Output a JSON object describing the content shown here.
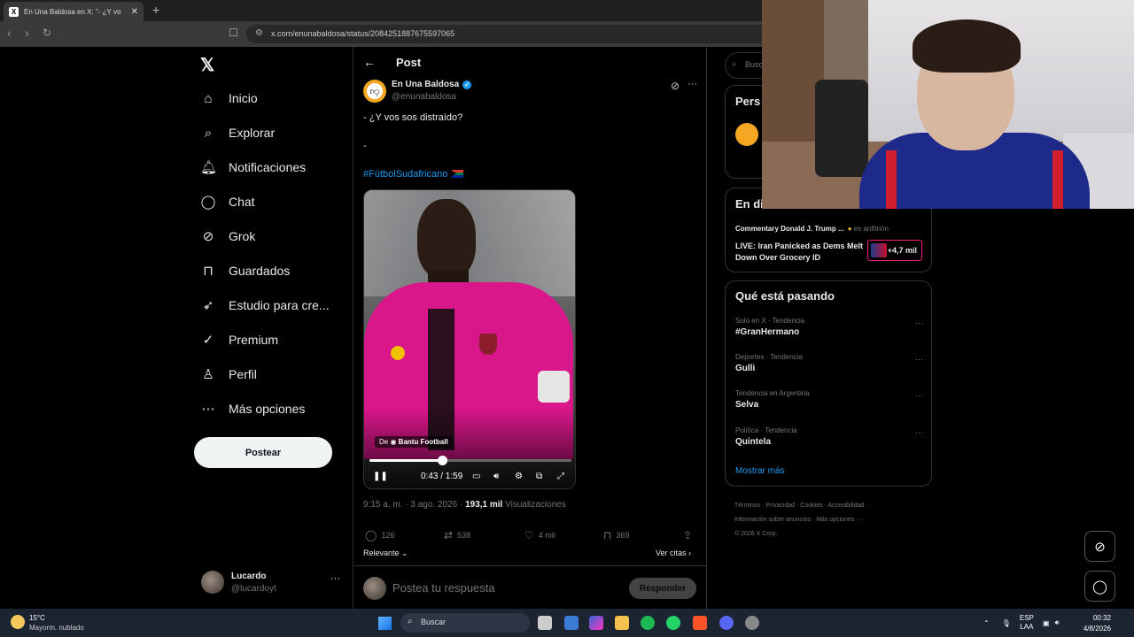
{
  "browser": {
    "tab_title": "En Una Baldosa en X: \"- ¿Y vo",
    "url": "x.com/enunabaldosa/status/2084251887675597065"
  },
  "nav": {
    "items": [
      {
        "label": "Inicio",
        "icon": "home-icon"
      },
      {
        "label": "Explorar",
        "icon": "search-icon"
      },
      {
        "label": "Notificaciones",
        "icon": "bell-icon"
      },
      {
        "label": "Chat",
        "icon": "chat-icon"
      },
      {
        "label": "Grok",
        "icon": "grok-icon"
      },
      {
        "label": "Guardados",
        "icon": "bookmark-icon"
      },
      {
        "label": "Estudio para cre...",
        "icon": "rocket-icon"
      },
      {
        "label": "Premium",
        "icon": "verified-icon"
      },
      {
        "label": "Perfil",
        "icon": "person-icon"
      },
      {
        "label": "Más opciones",
        "icon": "more-circle-icon"
      }
    ],
    "post_button": "Postear",
    "account": {
      "name": "Lucardo",
      "handle": "@lucardoyt"
    }
  },
  "post": {
    "header": "Post",
    "author_name": "En Una Baldosa",
    "author_handle": "@enunabaldosa",
    "text_line1": "- ¿Y vos sos distraído?",
    "text_line2": "-",
    "hashtag": "#FútbolSudafricano",
    "video": {
      "source_prefix": "De",
      "source_name": "Bantu Football",
      "time": "0:43 / 1:59",
      "progress": 0.36
    },
    "meta_time": "9:15 a. m. · 3 ago. 2026 · ",
    "meta_views": "193,1 mil",
    "meta_views_label": " Visualizaciones",
    "actions": {
      "replies": "126",
      "reposts": "538",
      "likes": "4 mil",
      "bookmarks": "369"
    },
    "relevant": "Relevante",
    "quotes": "Ver citas",
    "reply_placeholder": "Postea tu respuesta",
    "reply_button": "Responder"
  },
  "sidebar": {
    "search_placeholder": "Busc",
    "card1_title": "Pers",
    "live_title": "En di",
    "live_host": "Commentary Donald J. Trump ...",
    "live_host_role": "es anfitrión",
    "live_text": "LIVE: Iran Panicked as Dems Melt Down Over Grocery ID",
    "live_count": "+4,7 mil",
    "trends_title": "Qué está pasando",
    "trends": [
      {
        "category": "Solo en X · Tendencia",
        "name": "#GranHermano"
      },
      {
        "category": "Deportes · Tendencia",
        "name": "Gulli"
      },
      {
        "category": "Tendencia en Argentina",
        "name": "Selva"
      },
      {
        "category": "Política · Tendencia",
        "name": "Quintela"
      }
    ],
    "show_more": "Mostrar más",
    "footer_line1": "Términos  ·  Privacidad  ·  Cookies  ·  Accesibilidad  ·",
    "footer_line2": "Información sobre anuncios  ·  Más opciones ···",
    "footer_line3": "© 2026 X Corp."
  },
  "taskbar": {
    "temp": "15°C",
    "weather": "Mayorm. nublado",
    "search": "Buscar",
    "lang1": "ESP",
    "lang2": "LAA",
    "time": "00:32",
    "date": "4/8/2026"
  }
}
